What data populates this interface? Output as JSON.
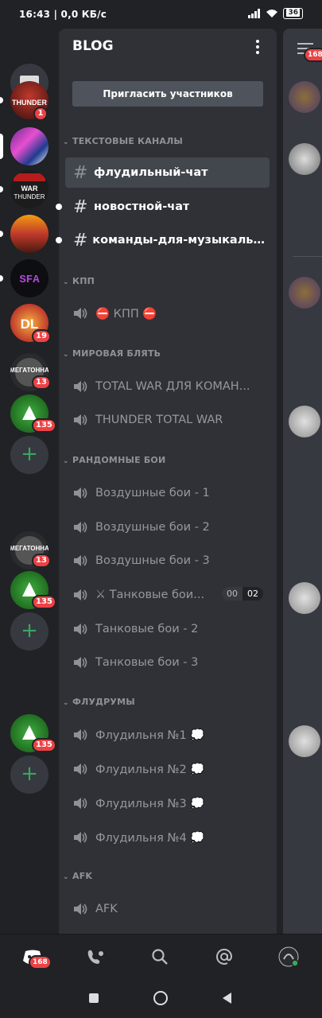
{
  "status_bar": {
    "time_speed": "16:43 | 0,0 КБ/с",
    "battery": "36"
  },
  "server_rail": {
    "servers": [
      {
        "name": "war-thunder-server",
        "badge": "1",
        "pill": true
      },
      {
        "name": "purple-server",
        "badge": "",
        "pill": false,
        "selected": true
      },
      {
        "name": "war-thunder-ru-server",
        "badge": "",
        "pill": true,
        "logo_text": "WAR THUNDER RU DISKORD"
      },
      {
        "name": "sunset-server",
        "badge": "",
        "pill": true
      },
      {
        "name": "sfa-server",
        "badge": "",
        "pill": true,
        "logo_text": "SFA"
      },
      {
        "name": "dl-server",
        "badge": "19",
        "pill": false,
        "logo_text": "DL"
      },
      {
        "name": "megatonna-server",
        "badge": "13",
        "pill": false,
        "logo_text": "МЕГАТОННА"
      },
      {
        "name": "green-server",
        "badge": "135",
        "pill": false
      },
      {
        "name": "megatonna-server-2",
        "badge": "13",
        "pill": false,
        "logo_text": "МЕГАТОННА"
      },
      {
        "name": "green-server-2",
        "badge": "135",
        "pill": false
      },
      {
        "name": "green-server-3",
        "badge": "135",
        "pill": false
      }
    ],
    "add_label": "+"
  },
  "channel_panel": {
    "server_title": "BLOG",
    "invite_label": "Пригласить участников",
    "categories": [
      {
        "label": "ТЕКСТОВЫЕ КАНАЛЫ",
        "channels": [
          {
            "type": "text",
            "name": "флудильный-чат",
            "selected": true,
            "unread": false
          },
          {
            "type": "text",
            "name": "новостной-чат",
            "selected": false,
            "unread": true
          },
          {
            "type": "text",
            "name": "команды-для-музыкально...",
            "selected": false,
            "unread": true
          }
        ]
      },
      {
        "label": "КПП",
        "channels": [
          {
            "type": "voice",
            "name": "⛔ КПП ⛔"
          }
        ]
      },
      {
        "label": "МИРОВАЯ БЛЯТЬ",
        "channels": [
          {
            "type": "voice",
            "name": "TOTAL WAR ДЛЯ КОМАН..."
          },
          {
            "type": "voice",
            "name": "THUNDER TOTAL WAR"
          }
        ]
      },
      {
        "label": "РАНДОМНЫЕ БОИ",
        "channels": [
          {
            "type": "voice",
            "name": "Воздушные бои - 1"
          },
          {
            "type": "voice",
            "name": "Воздушные бои - 2"
          },
          {
            "type": "voice",
            "name": "Воздушные бои - 3"
          },
          {
            "type": "voice",
            "name": "⚔ Танковые бои...",
            "count_current": "00",
            "count_limit": "02"
          },
          {
            "type": "voice",
            "name": "Танковые бои - 2"
          },
          {
            "type": "voice",
            "name": "Танковые бои - 3"
          }
        ]
      },
      {
        "label": "ФЛУДРУМЫ",
        "channels": [
          {
            "type": "voice",
            "name": "Флудильня №1 💭"
          },
          {
            "type": "voice",
            "name": "Флудильня №2 💭"
          },
          {
            "type": "voice",
            "name": "Флудильня №3 💭"
          },
          {
            "type": "voice",
            "name": "Флудильня №4 💭"
          }
        ]
      },
      {
        "label": "AFK",
        "channels": [
          {
            "type": "voice",
            "name": "AFK"
          }
        ]
      }
    ]
  },
  "member_list": {
    "badge": "168"
  },
  "bottom_tabs": {
    "home_badge": "168"
  },
  "colors": {
    "accent_red": "#ed4245",
    "green": "#3ba55d",
    "panel": "#2f3136",
    "rail": "#202225"
  }
}
